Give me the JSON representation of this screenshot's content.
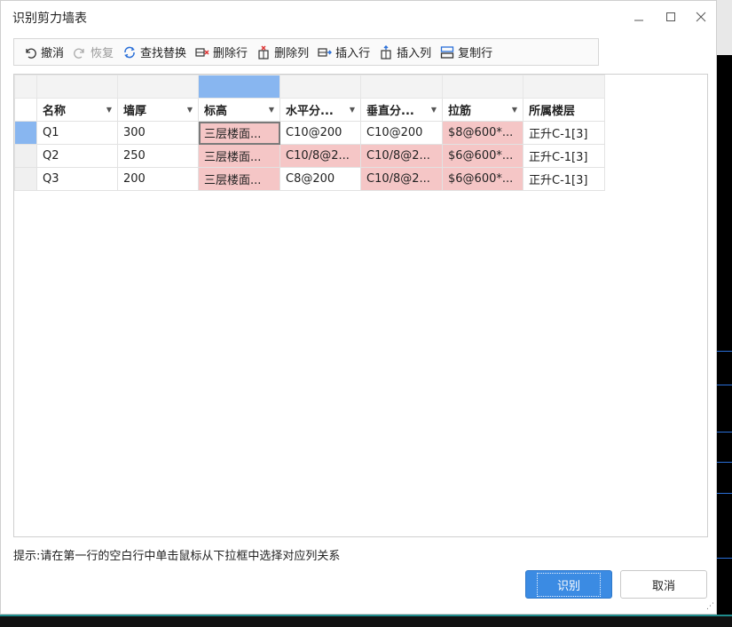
{
  "window": {
    "title": "识别剪力墙表"
  },
  "toolbar": {
    "undo": "撤消",
    "redo": "恢复",
    "find_replace": "查找替换",
    "delete_row": "删除行",
    "delete_col": "删除列",
    "insert_row": "插入行",
    "insert_col": "插入列",
    "copy_row": "复制行"
  },
  "grid": {
    "headers": [
      "名称",
      "墙厚",
      "标高",
      "水平分...",
      "垂直分...",
      "拉筋",
      "所属楼层"
    ],
    "rows": [
      [
        "Q1",
        "300",
        "三层楼面...",
        "C10@200",
        "C10@200",
        "$8@600*...",
        "正升C-1[3]"
      ],
      [
        "Q2",
        "250",
        "三层楼面...",
        "C10/8@2...",
        "C10/8@2...",
        "$6@600*...",
        "正升C-1[3]"
      ],
      [
        "Q3",
        "200",
        "三层楼面...",
        "C8@200",
        "C10/8@2...",
        "$6@600*...",
        "正升C-1[3]"
      ]
    ]
  },
  "hint": "提示:请在第一行的空白行中单击鼠标从下拉框中选择对应列关系",
  "buttons": {
    "recognize": "识别",
    "cancel": "取消"
  },
  "colors": {
    "selection": "#88b6f0",
    "highlight": "#f5c6c6",
    "primary": "#3b8be3"
  }
}
